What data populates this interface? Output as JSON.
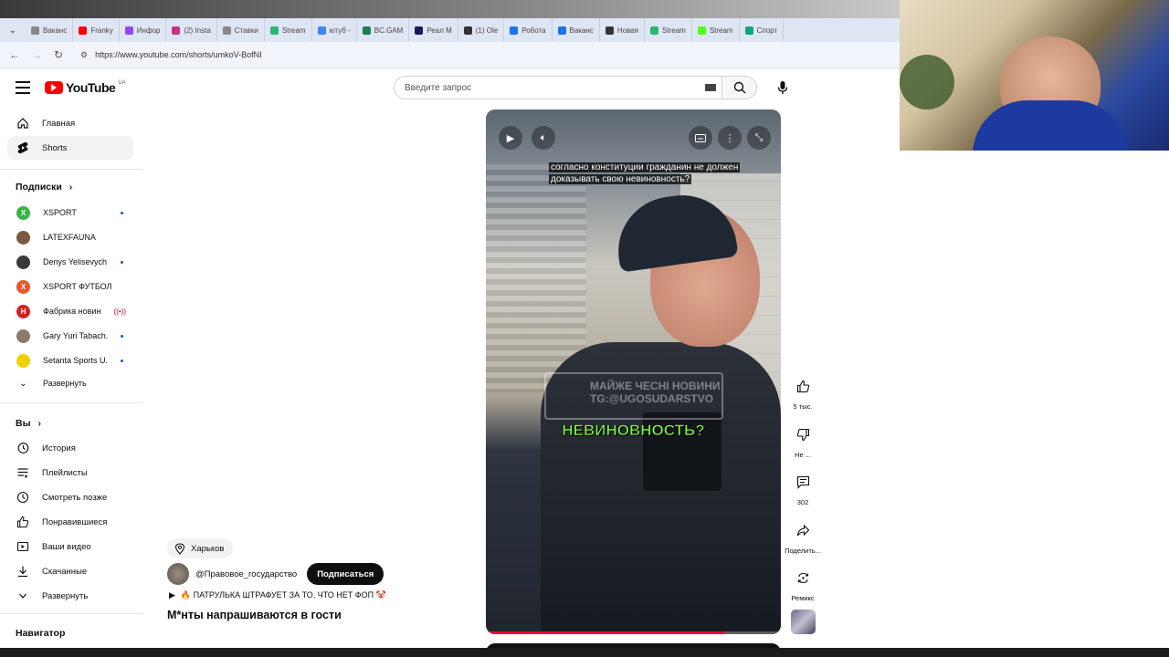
{
  "browser": {
    "url": "https://www.youtube.com/shorts/umkoV-BofNI",
    "tabs": [
      {
        "label": "Ваканс",
        "color": "#888888"
      },
      {
        "label": "Franky",
        "color": "#ff0000"
      },
      {
        "label": "Инфор",
        "color": "#9146ff"
      },
      {
        "label": "(2) Insta",
        "color": "#c13584"
      },
      {
        "label": "Ставки",
        "color": "#888888"
      },
      {
        "label": "Stream",
        "color": "#2bb673"
      },
      {
        "label": "ютуб -",
        "color": "#4285f4"
      },
      {
        "label": "BC.GAM",
        "color": "#1e7d4f"
      },
      {
        "label": "Реал М",
        "color": "#1a1a5a"
      },
      {
        "label": "(1) Ole",
        "color": "#333333"
      },
      {
        "label": "Робота",
        "color": "#1a73e8"
      },
      {
        "label": "Ваканс",
        "color": "#1a73e8"
      },
      {
        "label": "Новая",
        "color": "#333333"
      },
      {
        "label": "Stream",
        "color": "#2bb673"
      },
      {
        "label": "Stream",
        "color": "#53fc18"
      },
      {
        "label": "Спорт",
        "color": "#00a884"
      }
    ]
  },
  "youtube": {
    "logo_text": "YouTube",
    "logo_region": "UA",
    "search_placeholder": "Введите запрос",
    "accent": "#ff0000"
  },
  "sidebar": {
    "main": [
      {
        "label": "Главная",
        "icon": "home-icon"
      },
      {
        "label": "Shorts",
        "icon": "shorts-icon",
        "active": true
      }
    ],
    "subs_heading": "Подписки",
    "subscriptions": [
      {
        "name": "XSPORT",
        "badge": "dot",
        "avatar_color": "#38b24a",
        "avatar_letter": "X"
      },
      {
        "name": "LATEXFAUNA",
        "badge": "",
        "avatar_color": "#7a5a40",
        "avatar_letter": ""
      },
      {
        "name": "Denys Yelisevych",
        "badge": "dot",
        "avatar_color": "#3a3a3a",
        "avatar_letter": ""
      },
      {
        "name": "XSPORT ФУТБОЛ",
        "badge": "",
        "avatar_color": "#e8572a",
        "avatar_letter": "X"
      },
      {
        "name": "Фабрика новин",
        "badge": "live",
        "avatar_color": "#d32020",
        "avatar_letter": "H"
      },
      {
        "name": "Gary Yuri Tabach...",
        "badge": "dot",
        "avatar_color": "#8a7a6a",
        "avatar_letter": ""
      },
      {
        "name": "Setanta Sports U...",
        "badge": "dot",
        "avatar_color": "#f0d000",
        "avatar_letter": ""
      }
    ],
    "expand_label": "Развернуть",
    "you_heading": "Вы",
    "you_items": [
      {
        "label": "История",
        "icon": "history-icon"
      },
      {
        "label": "Плейлисты",
        "icon": "playlists-icon"
      },
      {
        "label": "Смотреть позже",
        "icon": "watch-later-icon"
      },
      {
        "label": "Понравившиеся",
        "icon": "liked-icon"
      },
      {
        "label": "Ваши видео",
        "icon": "your-videos-icon"
      },
      {
        "label": "Скачанные",
        "icon": "downloads-icon"
      },
      {
        "label": "Развернуть",
        "icon": "chevron-down-icon"
      }
    ],
    "navigator_heading": "Навигатор"
  },
  "short": {
    "subtitle": "согласно конституции гражданин не должен доказывать свою невиновность?",
    "overlay_word": "НЕВИНОВНОСТЬ?",
    "watermark": "МАЙЖЕ ЧЕСНІ НОВИНИ TG:@UGOSUDARSTVO",
    "progress_fraction": 0.81,
    "location": "Харьков",
    "channel": "@Правовое_государство",
    "subscribe_label": "Подписаться",
    "music": "🔥 ПАТРУЛЬКА ШТРАФУЕТ ЗА ТО, ЧТО НЕТ ФОП 🤡",
    "title": "М*нты напрашиваются в гости"
  },
  "actions": {
    "likes": "5 тыс.",
    "dislike": "Не ...",
    "comments": "302",
    "share": "Поделить...",
    "remix": "Ремикс"
  }
}
